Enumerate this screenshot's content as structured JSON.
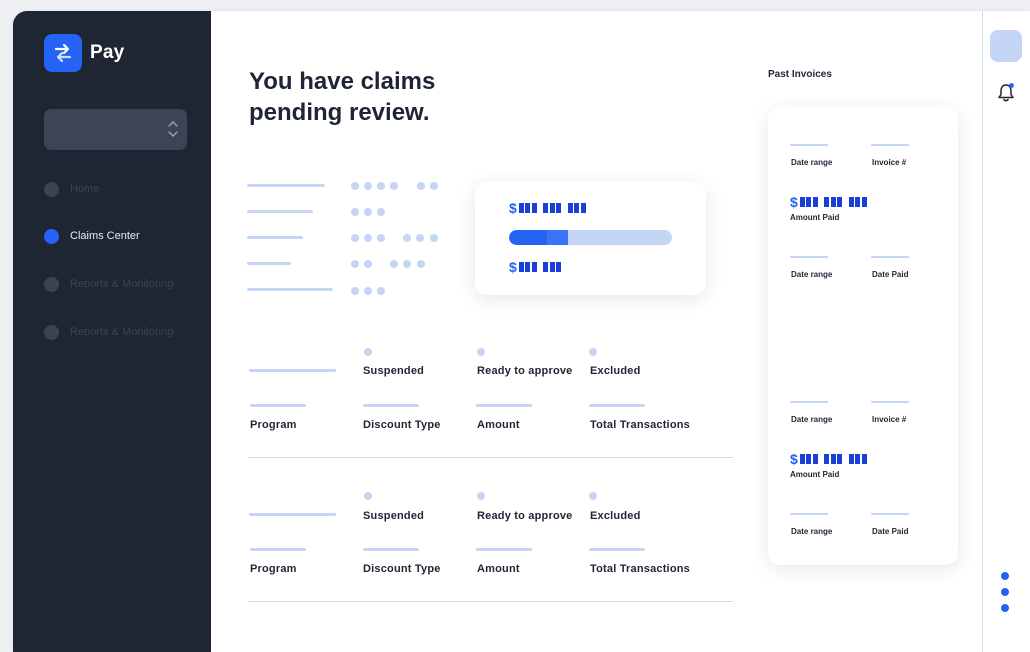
{
  "app": {
    "name": "Pay"
  },
  "sidebar": {
    "select_value": "",
    "items": [
      {
        "label": "Home",
        "active": false
      },
      {
        "label": "Claims Center",
        "active": true
      },
      {
        "label": "Reports & Monitoring",
        "active": false
      },
      {
        "label": "Reports & Monitoring",
        "active": false
      }
    ]
  },
  "main": {
    "title": "You have claims pending review.",
    "progress": {
      "fraction": 0.36
    },
    "tables": [
      {
        "status_labels": [
          "Suspended",
          "Ready to approve",
          "Excluded"
        ],
        "columns": [
          "Program",
          "Discount Type",
          "Amount",
          "Total Transactions"
        ]
      },
      {
        "status_labels": [
          "Suspended",
          "Ready to approve",
          "Excluded"
        ],
        "columns": [
          "Program",
          "Discount Type",
          "Amount",
          "Total Transactions"
        ]
      }
    ]
  },
  "invoices": {
    "heading": "Past Invoices",
    "groups": [
      {
        "date_range": "Date range",
        "invoice": "Invoice #",
        "amount_paid": "Amount Paid",
        "date_range2": "Date range",
        "date_paid": "Date Paid"
      },
      {
        "date_range": "Date range",
        "invoice": "Invoice #",
        "amount_paid": "Amount Paid",
        "date_range2": "Date range",
        "date_paid": "Date Paid"
      }
    ]
  },
  "colors": {
    "sidebar_bg": "#1e2533",
    "accent": "#2563f5",
    "placeholder": "#c5d5f6",
    "text": "#1e2533"
  },
  "icons": {
    "logo": "swap-arrows-icon",
    "select": "chevron-up-down-icon",
    "notifications": "bell-icon",
    "more": "vertical-dots-icon"
  }
}
